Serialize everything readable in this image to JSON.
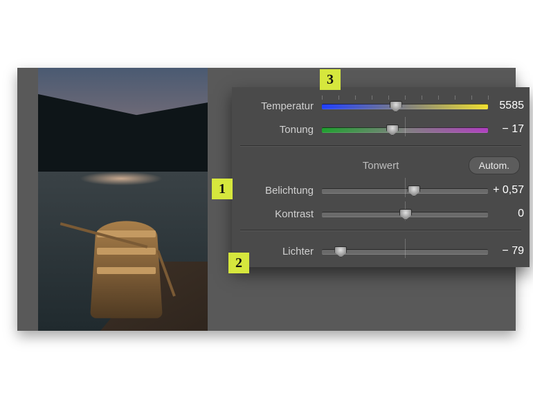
{
  "annotations": {
    "one": "1",
    "two": "2",
    "three": "3"
  },
  "panel": {
    "temperature": {
      "label": "Temperatur",
      "value": "5585",
      "handle_pct": 44
    },
    "tint": {
      "label": "Tonung",
      "value": "− 17",
      "handle_pct": 42
    },
    "section": {
      "title": "Tonwert",
      "auto_label": "Autom."
    },
    "exposure": {
      "label": "Belichtung",
      "value": "+ 0,57",
      "handle_pct": 55
    },
    "contrast": {
      "label": "Kontrast",
      "value": "0",
      "handle_pct": 50
    },
    "highlights": {
      "label": "Lichter",
      "value": "− 79",
      "handle_pct": 11
    }
  }
}
